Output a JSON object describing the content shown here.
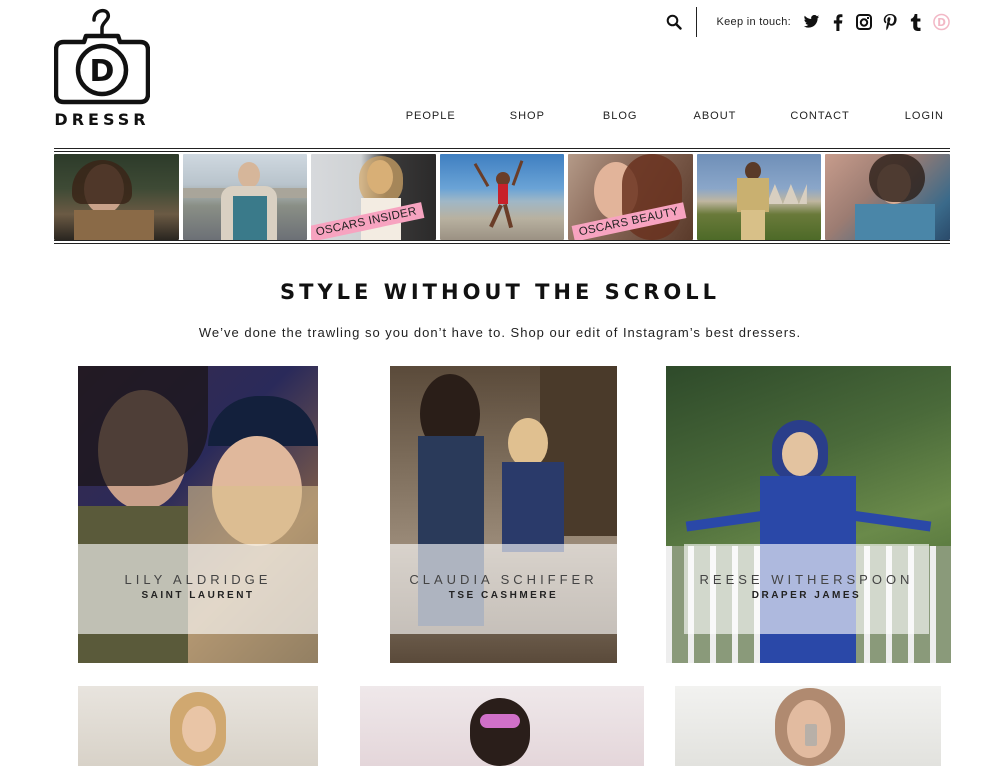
{
  "brand": {
    "logo_text": "DRESSR"
  },
  "topbar": {
    "search_icon": "search-icon",
    "keep_label": "Keep in touch:",
    "social": [
      "twitter-icon",
      "facebook-icon",
      "instagram-icon",
      "pinterest-icon",
      "tumblr-icon",
      "dressr-icon"
    ]
  },
  "nav": [
    "PEOPLE",
    "SHOP",
    "BLOG",
    "ABOUT",
    "CONTACT",
    "LOGIN"
  ],
  "strip": {
    "tags": [
      "OSCARS INSIDER",
      "OSCARS BEAUTY"
    ]
  },
  "hero": {
    "title": "STYLE WITHOUT THE SCROLL",
    "subtitle": "We’ve done the trawling so you don’t have to. Shop our edit of Instagram’s best dressers."
  },
  "cards": [
    {
      "name": "LILY ALDRIDGE",
      "brand": "SAINT LAURENT"
    },
    {
      "name": "CLAUDIA SCHIFFER",
      "brand": "TSE CASHMERE"
    },
    {
      "name": "REESE WITHERSPOON",
      "brand": "DRAPER JAMES"
    }
  ],
  "colors": {
    "accent_pink": "#f7a3c0",
    "text": "#1a1a1a",
    "rule": "#222222"
  }
}
